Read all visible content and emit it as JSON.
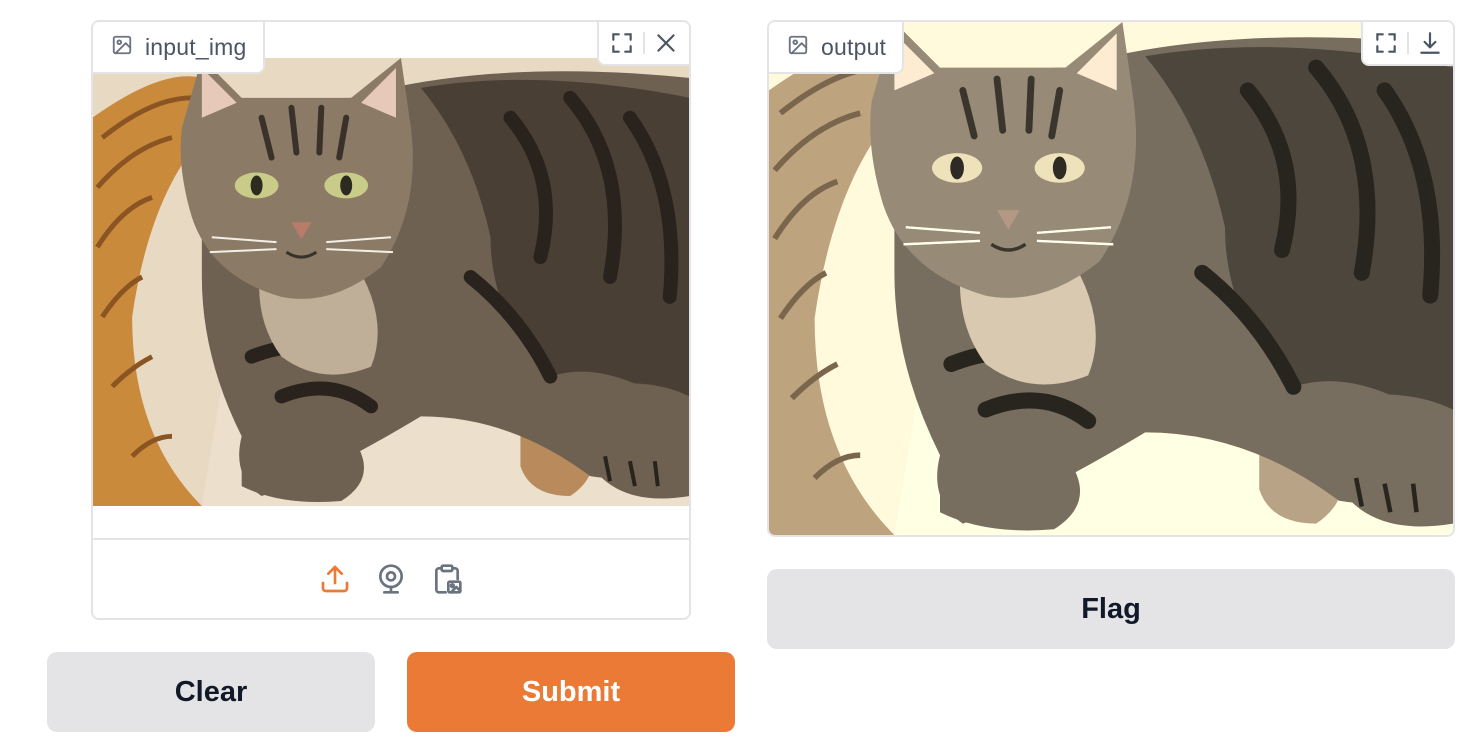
{
  "input_panel": {
    "label": "input_img",
    "label_icon": "image-icon",
    "actions": [
      "fullscreen-icon",
      "close-icon"
    ],
    "sources": [
      "upload-icon",
      "webcam-icon",
      "clipboard-icon"
    ]
  },
  "output_panel": {
    "label": "output",
    "label_icon": "image-icon",
    "actions": [
      "fullscreen-icon",
      "download-icon"
    ]
  },
  "buttons": {
    "clear": "Clear",
    "submit": "Submit",
    "flag": "Flag"
  },
  "colors": {
    "accent": "#ea7a35",
    "secondary_button": "#e4e4e7",
    "border": "#e4e4e7",
    "label_text": "#4b5563"
  }
}
